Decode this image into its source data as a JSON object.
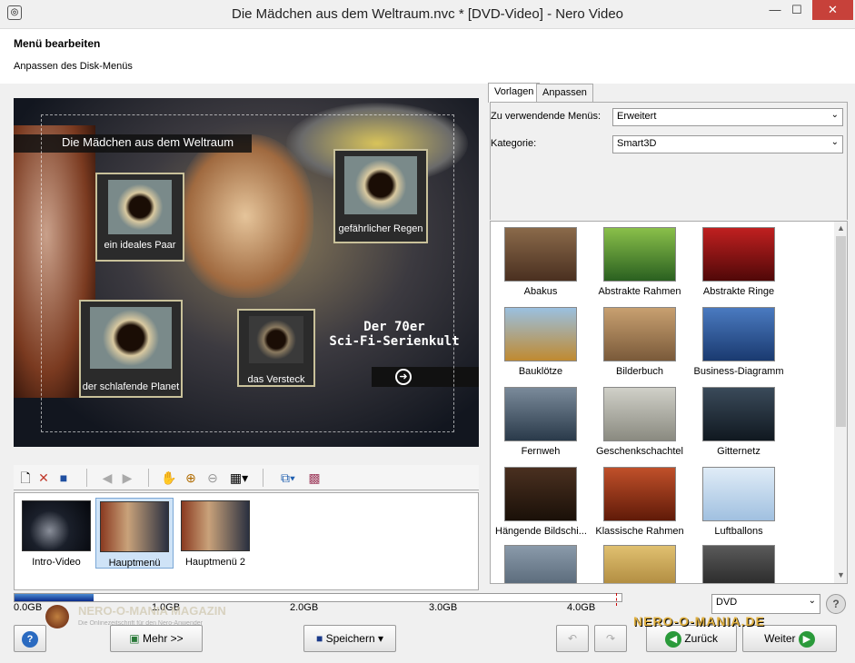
{
  "window": {
    "title": "Die Mädchen aus dem Weltraum.nvc * [DVD-Video] - Nero Video",
    "minimize": "—",
    "maximize": "☐",
    "close": "✕"
  },
  "header": {
    "title": "Menü bearbeiten",
    "subtitle": "Anpassen des Disk-Menüs"
  },
  "preview": {
    "menu_title": "Die Mädchen aus dem Weltraum",
    "buttons": [
      "ein ideales Paar",
      "gefährlicher Regen",
      "der schlafende Planet",
      "das Versteck"
    ],
    "promo_line1": "Der 70er",
    "promo_line2": "Sci-Fi-Serienkult"
  },
  "strip": {
    "items": [
      "Intro-Video",
      "Hauptmenü",
      "Hauptmenü 2"
    ]
  },
  "tabs": [
    "Vorlagen",
    "Anpassen"
  ],
  "form": {
    "menus_label": "Zu verwendende Menüs:",
    "menus_value": "Erweitert",
    "category_label": "Kategorie:",
    "category_value": "Smart3D"
  },
  "templates": [
    "Abakus",
    "Abstrakte Rahmen",
    "Abstrakte Ringe",
    "Bauklötze",
    "Bilderbuch",
    "Business-Diagramm",
    "Fernweh",
    "Geschenkschachtel",
    "Gitternetz",
    "Hängende Bildschi...",
    "Klassische Rahmen",
    "Luftballons"
  ],
  "disk": {
    "ticks": [
      "0.0GB",
      "1.0GB",
      "2.0GB",
      "3.0GB",
      "4.0GB"
    ],
    "type": "DVD",
    "used_fraction": 0.13,
    "capacity_marker_fraction": 0.99
  },
  "bottom": {
    "more": "Mehr >>",
    "save": "Speichern",
    "back": "Zurück",
    "next": "Weiter"
  },
  "watermark": {
    "left": "NERO-O-MANIA MAGAZIN",
    "left_sub": "Die Onlinezeitschrift für den Nero-Anwender",
    "right": "NERO-O-MANIA.DE"
  }
}
